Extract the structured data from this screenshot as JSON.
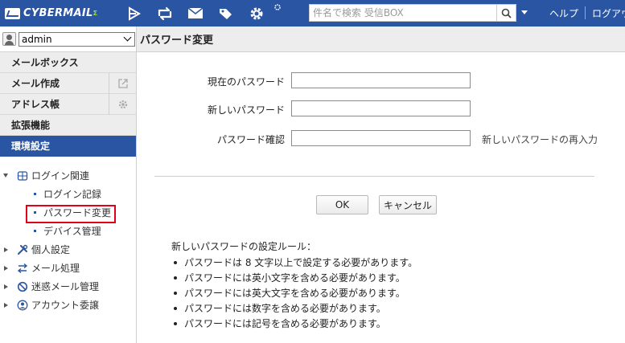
{
  "app": {
    "logo_text": "CYBERMAIL",
    "logo_sup": "Σ"
  },
  "topbar": {
    "search_placeholder": "件名で検索 受信BOX",
    "help_label": "ヘルプ",
    "logout_label": "ログアウト",
    "icons": [
      "mail-receive-icon",
      "mail-refresh-icon",
      "envelope-icon",
      "tag-icon",
      "gear-icon",
      "settings-small-icon"
    ]
  },
  "sidebar": {
    "user_select": "admin",
    "menu": [
      {
        "label": "メールボックス"
      },
      {
        "label": "メール作成",
        "side_icon": "external-link-icon"
      },
      {
        "label": "アドレス帳",
        "side_icon": "gear-icon"
      },
      {
        "label": "拡張機能"
      },
      {
        "label": "環境設定",
        "active": true
      }
    ],
    "tree": [
      {
        "label": "ログイン関連",
        "expanded": true,
        "icon": "globe-icon",
        "children": [
          "ログイン記録",
          "パスワード変更",
          "デバイス管理"
        ]
      },
      {
        "label": "個人設定",
        "icon": "tools-icon"
      },
      {
        "label": "メール処理",
        "icon": "arrows-icon"
      },
      {
        "label": "迷惑メール管理",
        "icon": "block-icon"
      },
      {
        "label": "アカウント委譲",
        "icon": "account-icon"
      }
    ]
  },
  "main": {
    "title": "パスワード変更",
    "fields": {
      "current_label": "現在のパスワード",
      "new_label": "新しいパスワード",
      "confirm_label": "パスワード確認",
      "confirm_hint": "新しいパスワードの再入力"
    },
    "buttons": {
      "ok": "OK",
      "cancel": "キャンセル"
    },
    "rules_title": "新しいパスワードの設定ルール：",
    "rules": [
      "パスワードは 8 文字以上で設定する必要があります。",
      "パスワードには英小文字を含める必要があります。",
      "パスワードには英大文字を含める必要があります。",
      "パスワードには数字を含める必要があります。",
      "パスワードには記号を含める必要があります。"
    ]
  },
  "colors": {
    "brand": "#2a55a3",
    "highlight": "#e1001a"
  }
}
